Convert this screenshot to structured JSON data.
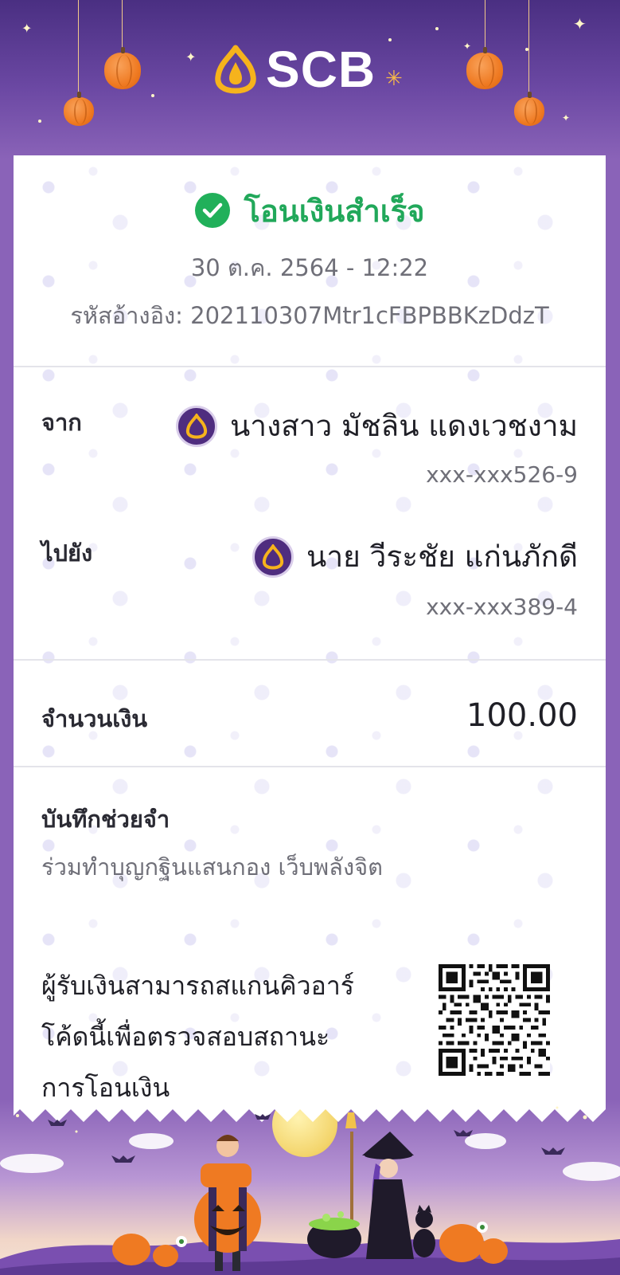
{
  "brand": {
    "name": "SCB",
    "logo_icon": "scb-lotus-icon"
  },
  "status": {
    "icon": "check-circle-icon",
    "text": "โอนเงินสำเร็จ",
    "datetime": "30 ต.ค. 2564 - 12:22",
    "reference": "รหัสอ้างอิง: 202110307Mtr1cFBPBBKzDdzT"
  },
  "from": {
    "label": "จาก",
    "name": "นางสาว มัชลิน แดงเวชงาม",
    "account": "xxx-xxx526-9",
    "bank_icon": "scb-bank-icon"
  },
  "to": {
    "label": "ไปยัง",
    "name": "นาย วีระชัย แก่นภักดี",
    "account": "xxx-xxx389-4",
    "bank_icon": "scb-bank-icon"
  },
  "amount": {
    "label": "จำนวนเงิน",
    "value": "100.00"
  },
  "memo": {
    "label": "บันทึกช่วยจำ",
    "text": "ร่วมทำบุญกฐินแสนกอง เว็บพลังจิต"
  },
  "qr": {
    "note_line1": "ผู้รับเงินสามารถสแกนคิวอาร์",
    "note_line2": "โค้ดนี้เพื่อตรวจสอบสถานะ",
    "note_line3": "การโอนเงิน",
    "icon": "qr-code-icon"
  },
  "colors": {
    "brand_purple": "#4f2d7f",
    "success_green": "#21b05a",
    "header_bg": "#6b48a3",
    "pumpkin_orange": "#ef7a22"
  }
}
